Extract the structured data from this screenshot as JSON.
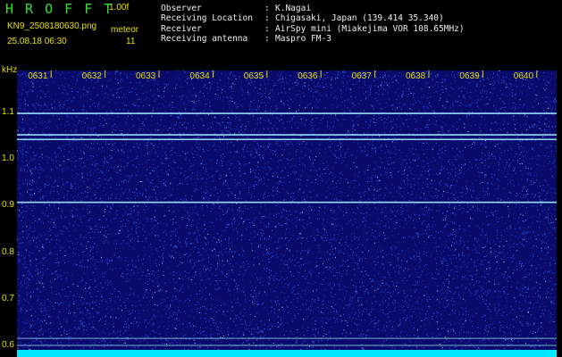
{
  "header": {
    "app_title": "H R O F F T",
    "version": "1.00f",
    "filename": "KN9_2508180630.png",
    "datetime": "25.08.18 06:30",
    "meteor_label": "meteor",
    "meteor_count": "11"
  },
  "info": {
    "rows": [
      {
        "label": "Observer",
        "sep": ":",
        "value": "K.Nagai"
      },
      {
        "label": "Receiving Location",
        "sep": ":",
        "value": "Chigasaki, Japan (139.414 35.340)"
      },
      {
        "label": "Receiver",
        "sep": ":",
        "value": "AirSpy mini (Miakejima VOR 108.65MHz)"
      },
      {
        "label": "Receiving antenna",
        "sep": ":",
        "value": "Maspro FM-3"
      }
    ]
  },
  "colors": {
    "background": "#000000",
    "spectrum_bg": "#0a0a6a",
    "noise_dot": "#3a6cff",
    "signal_line": "#9fe8ff",
    "bottom_band": "#00e8ff",
    "label_yellow": "#e8e000",
    "title_green": "#2fe02f"
  },
  "chart_data": {
    "type": "heatmap",
    "ylabel": "kHz",
    "y_ticks": [
      "1.1",
      "1.0",
      "0.9",
      "0.8",
      "0.7",
      "0.6"
    ],
    "ylim": [
      0.575,
      1.19
    ],
    "x_ticks": [
      "0631",
      "0632",
      "0633",
      "0634",
      "0635",
      "0636",
      "0637",
      "0638",
      "0639",
      "0640"
    ],
    "signal_lines_khz": [
      1.098,
      1.052,
      1.042,
      0.907,
      0.615,
      0.6
    ],
    "meteor_count": 11
  }
}
